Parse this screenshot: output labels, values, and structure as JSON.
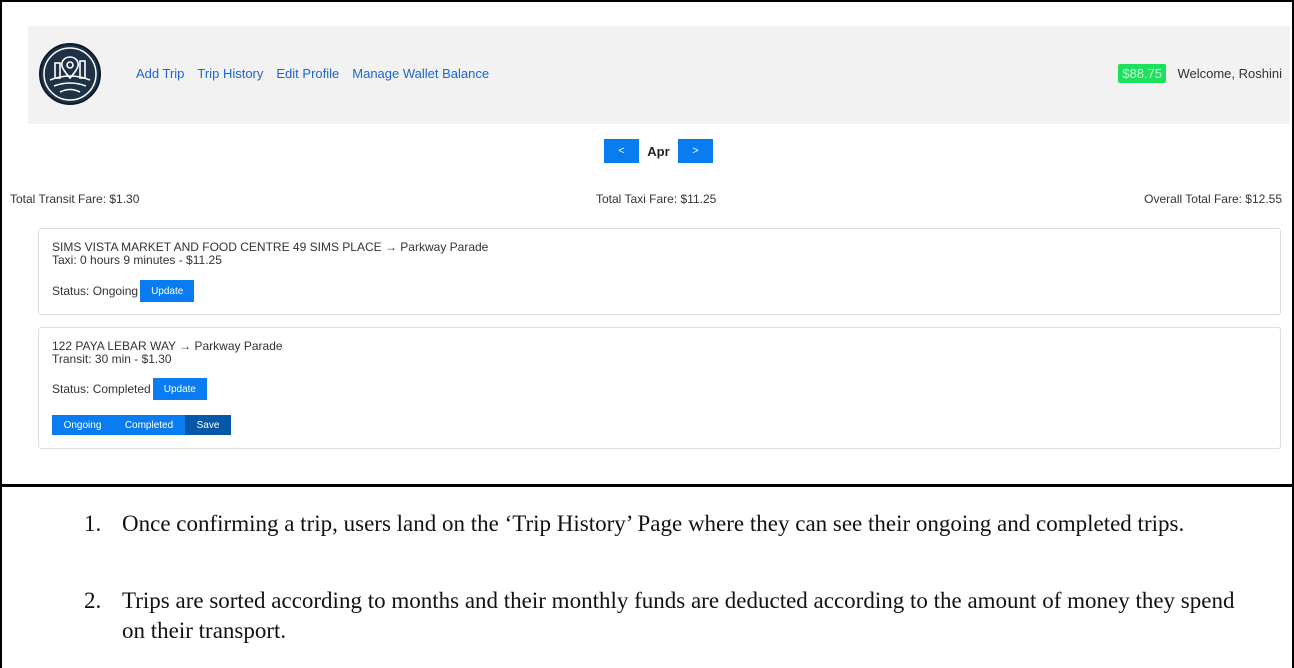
{
  "nav": {
    "links": [
      "Add Trip",
      "Trip History",
      "Edit Profile",
      "Manage Wallet Balance"
    ],
    "wallet_balance": "$88.75",
    "welcome": "Welcome, Roshini"
  },
  "month": {
    "prev_label": "<",
    "current": "Apr",
    "next_label": ">"
  },
  "totals": {
    "transit": "Total Transit Fare: $1.30",
    "taxi": "Total Taxi Fare: $11.25",
    "overall": "Overall Total Fare: $12.55"
  },
  "trips": [
    {
      "route": "SIMS VISTA MARKET AND FOOD CENTRE 49 SIMS PLACE → Parkway Parade",
      "mode": "Taxi: 0 hours 9 minutes - $11.25",
      "status": "Status: Ongoing",
      "update_label": "Update"
    },
    {
      "route": "122 PAYA LEBAR WAY → Parkway Parade",
      "mode": "Transit: 30 min - $1.30",
      "status": "Status: Completed",
      "update_label": "Update",
      "options": {
        "ongoing": "Ongoing",
        "completed": "Completed",
        "save": "Save"
      }
    }
  ],
  "notes": [
    {
      "num": "1.",
      "text": "Once confirming a trip, users land on the ‘Trip History’ Page where they can see their ongoing and completed trips."
    },
    {
      "num": "2.",
      "text": "Trips are sorted according to months and their monthly funds are deducted according to the amount of money they spend on their transport."
    }
  ],
  "colors": {
    "primary_button": "#0a7cf2",
    "save_button": "#0757a8",
    "wallet_badge": "#1de15c",
    "nav_link": "#1a66d6",
    "navbar_bg": "#f2f2f2"
  }
}
